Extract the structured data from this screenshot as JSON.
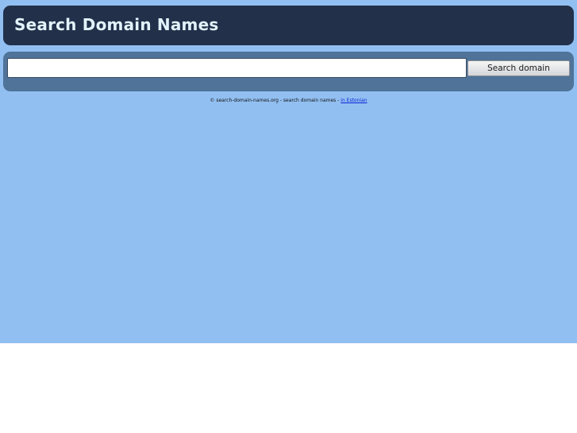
{
  "header": {
    "title": "Search Domain Names"
  },
  "search": {
    "input_value": "",
    "placeholder": "",
    "button_label": "Search domain"
  },
  "footer": {
    "text": "© search-domain-names.org - search domain names - ",
    "link_label": "in Estonian"
  },
  "colors": {
    "page_background": "#92bff1",
    "header_background": "#22304a",
    "title_color": "#e3f3fb",
    "search_panel_background": "#4f7399",
    "link_color": "#0b24d6"
  }
}
